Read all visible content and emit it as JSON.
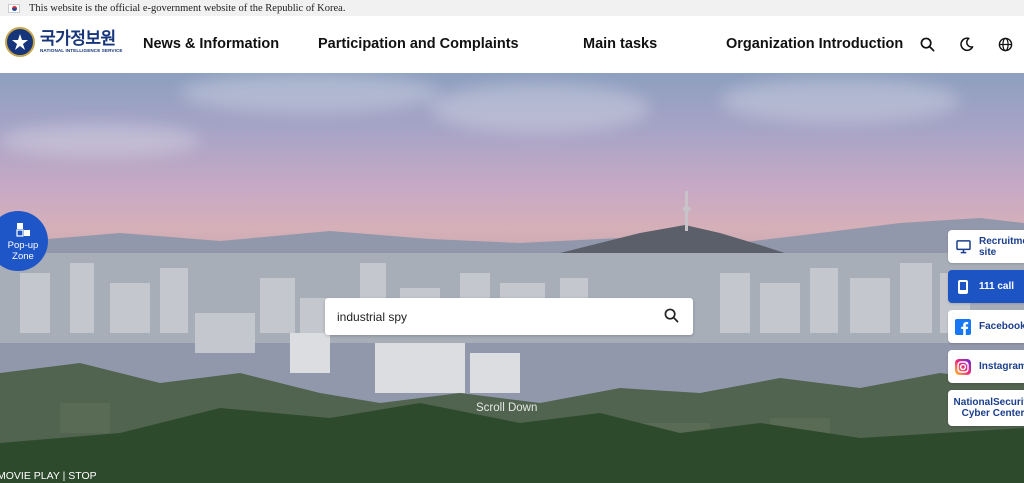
{
  "gov_banner": {
    "text": "This website is the official e-government website of the Republic of Korea."
  },
  "logo": {
    "korean": "국가정보원",
    "english": "NATIONAL INTELLIGENCE SERVICE"
  },
  "nav": {
    "items": [
      {
        "label": "News & Information"
      },
      {
        "label": "Participation and Complaints"
      },
      {
        "label": "Main tasks"
      },
      {
        "label": "Organization Introduction"
      }
    ]
  },
  "header_icons": [
    "search-icon",
    "dark-mode-moon-icon",
    "language-globe-icon"
  ],
  "popup_zone": {
    "label_line1": "Pop-up",
    "label_line2": "Zone"
  },
  "search": {
    "value": "industrial spy",
    "placeholder": ""
  },
  "scroll_down": "Scroll Down",
  "movie_control": {
    "play": "MOVIE PLAY",
    "separator": "|",
    "stop": "STOP"
  },
  "quick_menu": [
    {
      "label": "Recruitment site",
      "icon": "monitor-icon"
    },
    {
      "label": "111 call",
      "icon": "phone-icon"
    },
    {
      "label": "Facebook",
      "icon": "facebook-icon"
    },
    {
      "label": "Instagram",
      "icon": "instagram-icon"
    },
    {
      "label": "NationalSecurity Cyber Center",
      "icon": ""
    }
  ],
  "colors": {
    "brand_navy": "#16357a",
    "accent_blue": "#1d54c4",
    "gold": "#c9a64a"
  }
}
